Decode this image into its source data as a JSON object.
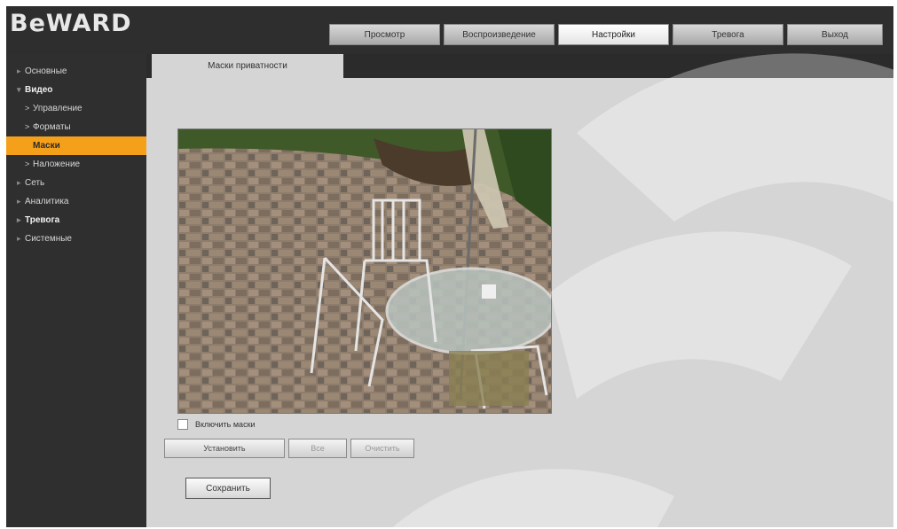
{
  "app": {
    "logo_text": "BeWARD"
  },
  "top_tabs": [
    {
      "label": "Просмотр",
      "active": false
    },
    {
      "label": "Воспроизведение",
      "active": false
    },
    {
      "label": "Настройки",
      "active": true
    },
    {
      "label": "Тревога",
      "active": false
    },
    {
      "label": "Выход",
      "active": false
    }
  ],
  "sidebar": {
    "items": [
      {
        "label": "Основные",
        "level": 0,
        "active": false
      },
      {
        "label": "Видео",
        "level": 0,
        "active": false,
        "bold": true
      },
      {
        "label": "Управление",
        "level": 1,
        "active": false
      },
      {
        "label": "Форматы",
        "level": 1,
        "active": false
      },
      {
        "label": "Маски",
        "level": 1,
        "active": true
      },
      {
        "label": "Наложение",
        "level": 1,
        "active": false
      },
      {
        "label": "Сеть",
        "level": 0,
        "active": false
      },
      {
        "label": "Аналитика",
        "level": 0,
        "active": false
      },
      {
        "label": "Тревога",
        "level": 0,
        "active": false,
        "bold": true
      },
      {
        "label": "Системные",
        "level": 0,
        "active": false
      }
    ]
  },
  "content": {
    "tab_label": "Маски приватности",
    "checkbox_label": "Включить маски",
    "buttons": [
      {
        "label": "Установить",
        "disabled": false
      },
      {
        "label": "Все",
        "disabled": true
      },
      {
        "label": "Очистить",
        "disabled": true
      }
    ],
    "save_label": "Сохранить"
  },
  "colors": {
    "accent": "#f5a01a",
    "dark_background": "#2b2b2b",
    "content_background": "#d5d5d5"
  }
}
